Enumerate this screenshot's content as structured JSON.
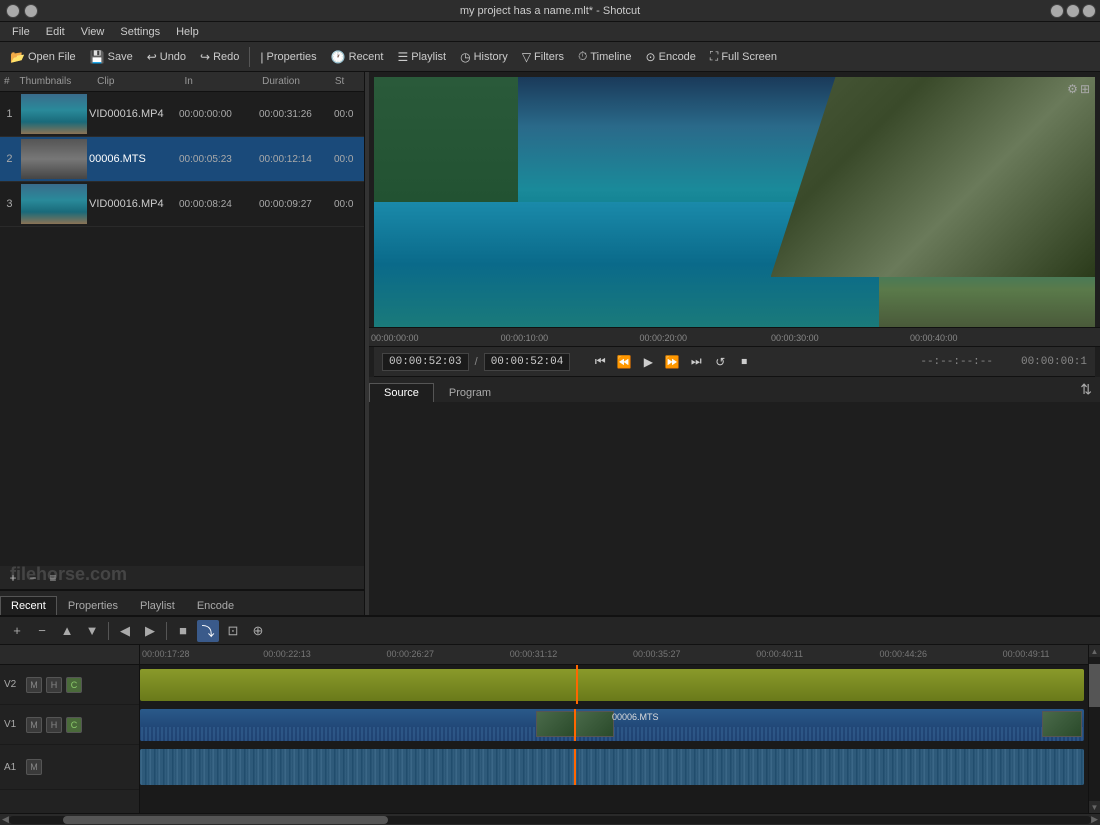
{
  "window": {
    "title": "my project has a name.mlt* - Shotcut",
    "minimize": "−",
    "maximize": "□",
    "close": "×"
  },
  "menubar": {
    "items": [
      "File",
      "Edit",
      "View",
      "Settings",
      "Help"
    ]
  },
  "toolbar": {
    "open_file": "Open File",
    "save": "Save",
    "undo": "Undo",
    "redo": "Redo",
    "properties": "Properties",
    "recent": "Recent",
    "playlist": "Playlist",
    "history": "History",
    "filters": "Filters",
    "timeline": "Timeline",
    "encode": "Encode",
    "full_screen": "Full Screen"
  },
  "clip_list": {
    "columns": [
      "#",
      "Thumbnails",
      "Clip",
      "In",
      "Duration",
      "St"
    ],
    "rows": [
      {
        "num": "1",
        "name": "VID00016.MP4",
        "in": "00:00:00:00",
        "duration": "00:00:31:26",
        "st": "00:0"
      },
      {
        "num": "2",
        "name": "00006.MTS",
        "in": "00:00:05:23",
        "duration": "00:00:12:14",
        "st": "00:0",
        "selected": true
      },
      {
        "num": "3",
        "name": "VID00016.MP4",
        "in": "00:00:08:24",
        "duration": "00:00:09:27",
        "st": "00:0"
      }
    ]
  },
  "bottom_left_icons": {
    "add": "+",
    "remove": "−",
    "menu": "≡"
  },
  "bottom_tabs": {
    "tabs": [
      "Recent",
      "Properties",
      "Playlist",
      "Encode"
    ]
  },
  "transport": {
    "current_time": "00:00:52:03",
    "total_time": "00:00:52:04",
    "right_time": "--:--:--:--",
    "end_time": "00:00:00:1"
  },
  "preview_tabs": {
    "tabs": [
      "Source",
      "Program"
    ],
    "active": "Source"
  },
  "timeline_toolbar": {
    "add": "+",
    "remove_track": "−",
    "up": "▲",
    "down": "▼",
    "forward": "▶",
    "back": "◀",
    "append": "■",
    "ripple": "~",
    "overwrite": "⊡",
    "scrub": "⊕"
  },
  "tracks": [
    {
      "name": "V2",
      "buttons": [
        "M",
        "H",
        "C"
      ]
    },
    {
      "name": "V1",
      "buttons": [
        "M",
        "H",
        "C"
      ]
    },
    {
      "name": "A1",
      "buttons": [
        "M"
      ]
    }
  ],
  "timeline_ruler": {
    "marks": [
      "00:00:17:28",
      "00:00:22:13",
      "00:00:26:27",
      "00:00:31:12",
      "00:00:35:27",
      "00:00:40:11",
      "00:00:44:26",
      "00:00:49:11"
    ]
  },
  "top_ruler": {
    "marks": [
      "00:00:00:00",
      "00:00:10:00",
      "00:00:20:00",
      "00:00:30:00",
      "00:00:40:00"
    ]
  },
  "clip_v1_label": "00006.MTS",
  "watermark": "filehorse.com"
}
